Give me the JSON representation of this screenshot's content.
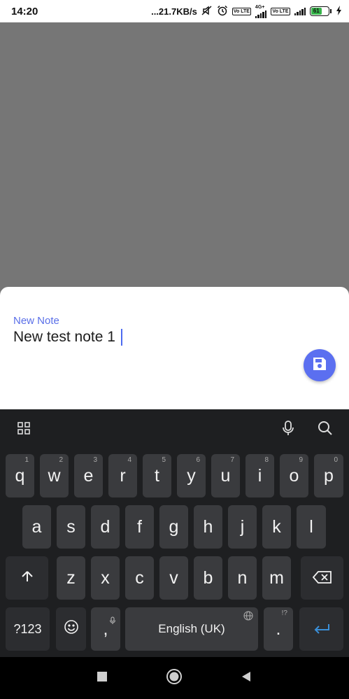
{
  "status_bar": {
    "time": "14:20",
    "network_speed": "...21.7KB/s",
    "volte1": "Vo LTE",
    "network_type": "4G+",
    "volte2": "Vo LTE",
    "battery_level": "61"
  },
  "sheet": {
    "label": "New Note",
    "input_value": "New test note 1",
    "save_icon": "save-icon",
    "accent_color": "#5b6ff0"
  },
  "keyboard": {
    "toolbar": {
      "left_icon": "grid-icon",
      "mic_icon": "mic-icon",
      "search_icon": "search-icon"
    },
    "row1": [
      {
        "label": "q",
        "hint": "1"
      },
      {
        "label": "w",
        "hint": "2"
      },
      {
        "label": "e",
        "hint": "3"
      },
      {
        "label": "r",
        "hint": "4"
      },
      {
        "label": "t",
        "hint": "5"
      },
      {
        "label": "y",
        "hint": "6"
      },
      {
        "label": "u",
        "hint": "7"
      },
      {
        "label": "i",
        "hint": "8"
      },
      {
        "label": "o",
        "hint": "9"
      },
      {
        "label": "p",
        "hint": "0"
      }
    ],
    "row2": [
      "a",
      "s",
      "d",
      "f",
      "g",
      "h",
      "j",
      "k",
      "l"
    ],
    "row3": [
      "z",
      "x",
      "c",
      "v",
      "b",
      "n",
      "m"
    ],
    "row4": {
      "symbols": "?123",
      "comma": ",",
      "space": "English (UK)",
      "period": ".",
      "period_hint": "!?"
    }
  }
}
